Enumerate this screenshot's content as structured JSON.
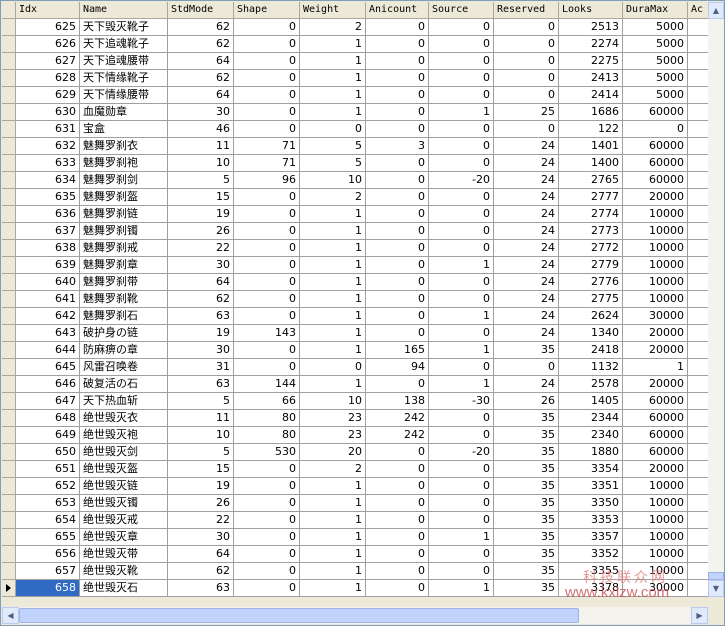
{
  "columns": [
    "Idx",
    "Name",
    "StdMode",
    "Shape",
    "Weight",
    "Anicount",
    "Source",
    "Reserved",
    "Looks",
    "DuraMax",
    "Ac"
  ],
  "rows": [
    [
      "625",
      "天下毁灭靴子",
      "62",
      "0",
      "2",
      "0",
      "0",
      "0",
      "2513",
      "5000"
    ],
    [
      "626",
      "天下追魂靴子",
      "62",
      "0",
      "1",
      "0",
      "0",
      "0",
      "2274",
      "5000"
    ],
    [
      "627",
      "天下追魂腰带",
      "64",
      "0",
      "1",
      "0",
      "0",
      "0",
      "2275",
      "5000"
    ],
    [
      "628",
      "天下情缘靴子",
      "62",
      "0",
      "1",
      "0",
      "0",
      "0",
      "2413",
      "5000"
    ],
    [
      "629",
      "天下情缘腰带",
      "64",
      "0",
      "1",
      "0",
      "0",
      "0",
      "2414",
      "5000"
    ],
    [
      "630",
      "血魔勋章",
      "30",
      "0",
      "1",
      "0",
      "1",
      "25",
      "1686",
      "60000"
    ],
    [
      "631",
      "宝盒",
      "46",
      "0",
      "0",
      "0",
      "0",
      "0",
      "122",
      "0"
    ],
    [
      "632",
      "魅舞罗刹衣",
      "11",
      "71",
      "5",
      "3",
      "0",
      "24",
      "1401",
      "60000"
    ],
    [
      "633",
      "魅舞罗刹袍",
      "10",
      "71",
      "5",
      "0",
      "0",
      "24",
      "1400",
      "60000"
    ],
    [
      "634",
      "魅舞罗刹剑",
      "5",
      "96",
      "10",
      "0",
      "-20",
      "24",
      "2765",
      "60000"
    ],
    [
      "635",
      "魅舞罗刹盔",
      "15",
      "0",
      "2",
      "0",
      "0",
      "24",
      "2777",
      "20000"
    ],
    [
      "636",
      "魅舞罗刹链",
      "19",
      "0",
      "1",
      "0",
      "0",
      "24",
      "2774",
      "10000"
    ],
    [
      "637",
      "魅舞罗刹镯",
      "26",
      "0",
      "1",
      "0",
      "0",
      "24",
      "2773",
      "10000"
    ],
    [
      "638",
      "魅舞罗刹戒",
      "22",
      "0",
      "1",
      "0",
      "0",
      "24",
      "2772",
      "10000"
    ],
    [
      "639",
      "魅舞罗刹章",
      "30",
      "0",
      "1",
      "0",
      "1",
      "24",
      "2779",
      "10000"
    ],
    [
      "640",
      "魅舞罗刹带",
      "64",
      "0",
      "1",
      "0",
      "0",
      "24",
      "2776",
      "10000"
    ],
    [
      "641",
      "魅舞罗刹靴",
      "62",
      "0",
      "1",
      "0",
      "0",
      "24",
      "2775",
      "10000"
    ],
    [
      "642",
      "魅舞罗刹石",
      "63",
      "0",
      "1",
      "0",
      "1",
      "24",
      "2624",
      "30000"
    ],
    [
      "643",
      "破护身の链",
      "19",
      "143",
      "1",
      "0",
      "0",
      "24",
      "1340",
      "20000"
    ],
    [
      "644",
      "防麻痹の章",
      "30",
      "0",
      "1",
      "165",
      "1",
      "35",
      "2418",
      "20000"
    ],
    [
      "645",
      "风雷召唤卷",
      "31",
      "0",
      "0",
      "94",
      "0",
      "0",
      "1132",
      "1"
    ],
    [
      "646",
      "破复活の石",
      "63",
      "144",
      "1",
      "0",
      "1",
      "24",
      "2578",
      "20000"
    ],
    [
      "647",
      "天下热血斩",
      "5",
      "66",
      "10",
      "138",
      "-30",
      "26",
      "1405",
      "60000"
    ],
    [
      "648",
      "绝世毁灭衣",
      "11",
      "80",
      "23",
      "242",
      "0",
      "35",
      "2344",
      "60000"
    ],
    [
      "649",
      "绝世毁灭袍",
      "10",
      "80",
      "23",
      "242",
      "0",
      "35",
      "2340",
      "60000"
    ],
    [
      "650",
      "绝世毁灭剑",
      "5",
      "530",
      "20",
      "0",
      "-20",
      "35",
      "1880",
      "60000"
    ],
    [
      "651",
      "绝世毁灭盔",
      "15",
      "0",
      "2",
      "0",
      "0",
      "35",
      "3354",
      "20000"
    ],
    [
      "652",
      "绝世毁灭链",
      "19",
      "0",
      "1",
      "0",
      "0",
      "35",
      "3351",
      "10000"
    ],
    [
      "653",
      "绝世毁灭镯",
      "26",
      "0",
      "1",
      "0",
      "0",
      "35",
      "3350",
      "10000"
    ],
    [
      "654",
      "绝世毁灭戒",
      "22",
      "0",
      "1",
      "0",
      "0",
      "35",
      "3353",
      "10000"
    ],
    [
      "655",
      "绝世毁灭章",
      "30",
      "0",
      "1",
      "0",
      "1",
      "35",
      "3357",
      "10000"
    ],
    [
      "656",
      "绝世毁灭带",
      "64",
      "0",
      "1",
      "0",
      "0",
      "35",
      "3352",
      "10000"
    ],
    [
      "657",
      "绝世毁灭靴",
      "62",
      "0",
      "1",
      "0",
      "0",
      "35",
      "3355",
      "10000"
    ],
    [
      "658",
      "绝世毁灭石",
      "63",
      "0",
      "1",
      "0",
      "1",
      "35",
      "3378",
      "30000"
    ]
  ],
  "selected_row_idx": "658",
  "watermark": {
    "text_cn": "科技联众网",
    "url": "www.kxlzw.com"
  },
  "icons": {
    "row_indicator": "selected-row-triangle-icon",
    "scroll_up": "arrow-up-icon",
    "scroll_down": "arrow-down-icon",
    "scroll_left": "arrow-left-icon",
    "scroll_right": "arrow-right-icon"
  },
  "colors": {
    "selection": "#316ac5",
    "grid_line": "#a0a0a0",
    "header_bg": "#ece9d8"
  }
}
